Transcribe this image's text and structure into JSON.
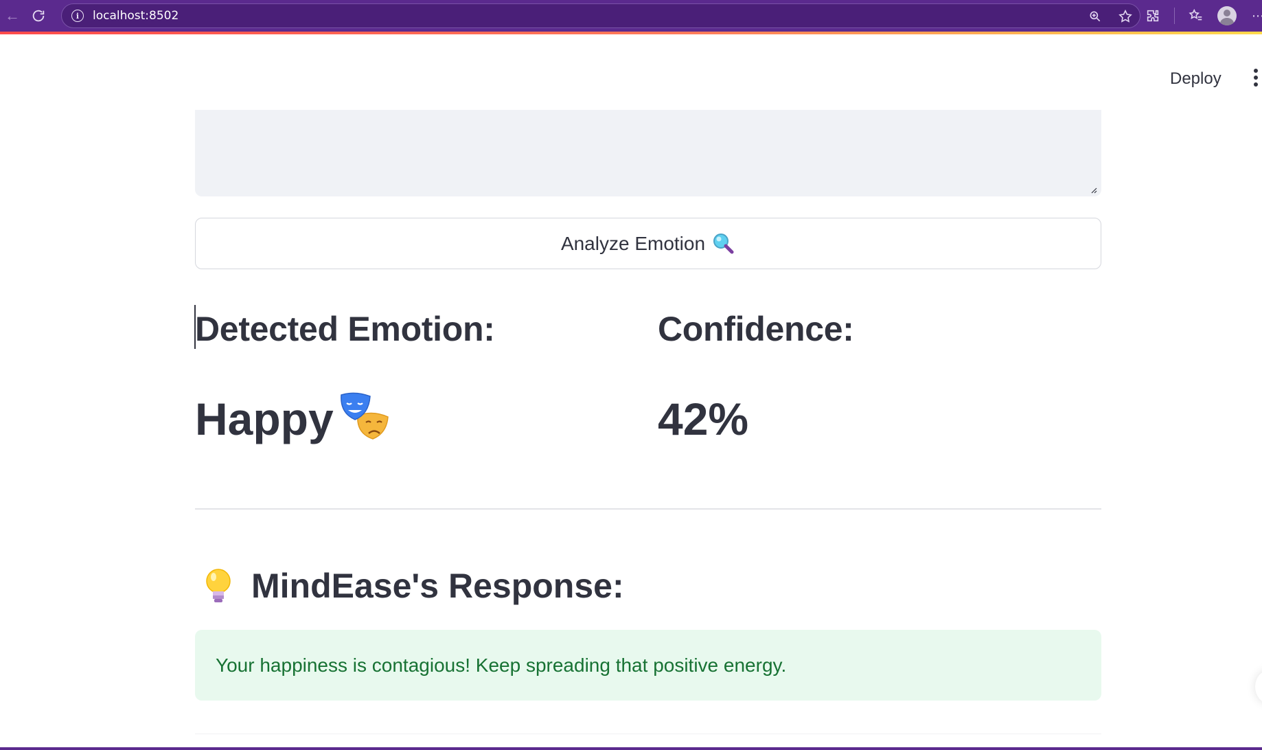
{
  "browser": {
    "url": "localhost:8502"
  },
  "header": {
    "deploy_label": "Deploy"
  },
  "main": {
    "analyze_button_label": "Analyze Emotion",
    "detected_emotion_heading": "Detected Emotion:",
    "detected_emotion_value": "Happy",
    "confidence_heading": "Confidence:",
    "confidence_value": "42%",
    "response_heading": "MindEase's Response:",
    "response_message": "Your happiness is contagious! Keep spreading that positive energy."
  },
  "icons": {
    "analyze": "magnifying-glass-icon",
    "emotion": "performing-arts-masks-icon",
    "response": "light-bulb-icon"
  },
  "colors": {
    "browser_bar": "#5b2a8e",
    "accent_gradient_start": "#ff4b4b",
    "accent_gradient_end": "#ffd94b",
    "success_background": "#e8f9ee",
    "success_text": "#177233",
    "text_primary": "#31333f"
  }
}
